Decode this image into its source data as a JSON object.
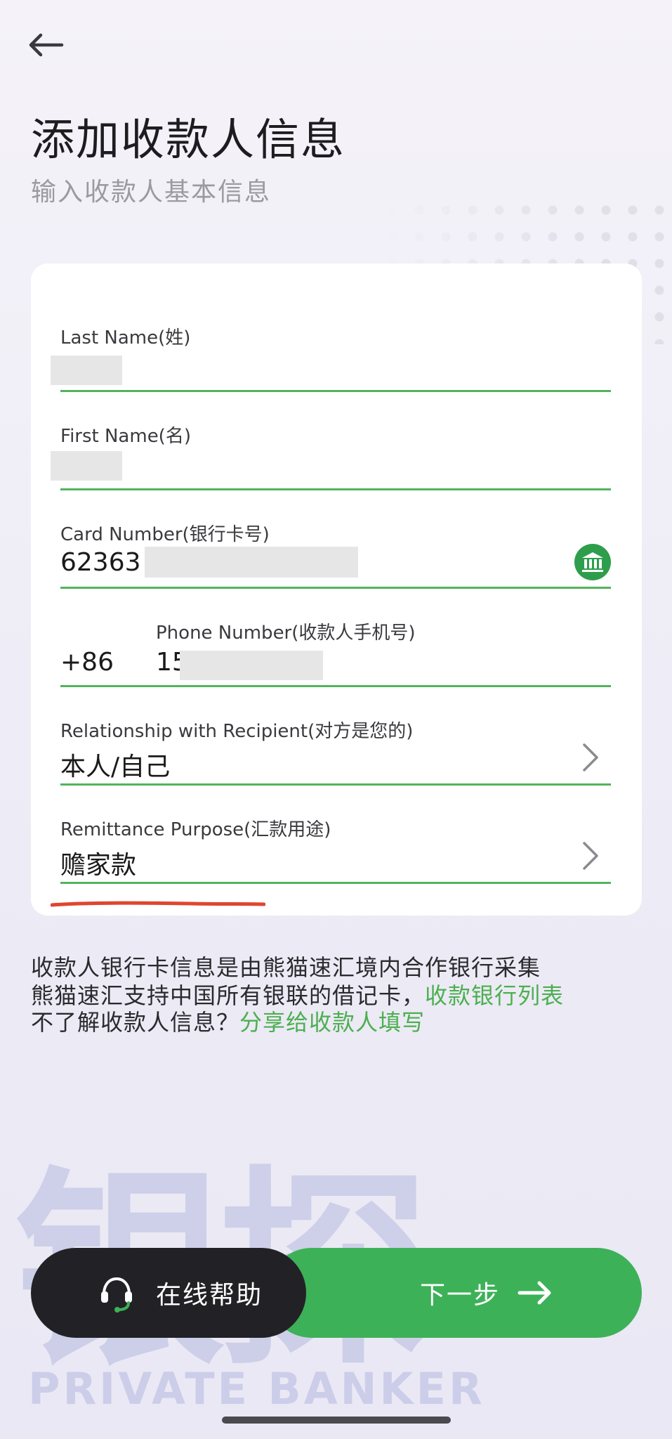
{
  "header": {
    "title": "添加收款人信息",
    "subtitle": "输入收款人基本信息"
  },
  "form": {
    "last_name": {
      "label": "Last Name(姓)",
      "value": ""
    },
    "first_name": {
      "label": "First Name(名)",
      "value": ""
    },
    "card_number": {
      "label": "Card Number(银行卡号)",
      "value": "62363"
    },
    "phone": {
      "label": "Phone Number(收款人手机号)",
      "country_code": "+86",
      "value": "15"
    },
    "relationship": {
      "label": "Relationship with Recipient(对方是您的)",
      "value": "本人/自己"
    },
    "purpose": {
      "label": "Remittance Purpose(汇款用途)",
      "value": "赡家款"
    }
  },
  "info": {
    "line1": "收款人银行卡信息是由熊猫速汇境内合作银行采集",
    "line2_text": "熊猫速汇支持中国所有银联的借记卡，",
    "line2_link": "收款银行列表",
    "line3_text": "不了解收款人信息？",
    "line3_link": "分享给收款人填写"
  },
  "buttons": {
    "help_label": "在线帮助",
    "next_label": "下一步"
  },
  "watermark": {
    "cn": "银探",
    "en": "PRIVATE BANKER"
  },
  "colors": {
    "accent_green": "#3db158",
    "field_underline": "#52b45b",
    "dark_button": "#222226"
  },
  "icons": {
    "back": "arrow-left-icon",
    "bank": "bank-icon",
    "chevron": "chevron-right-icon",
    "help": "headset-icon",
    "next": "arrow-right-icon"
  }
}
